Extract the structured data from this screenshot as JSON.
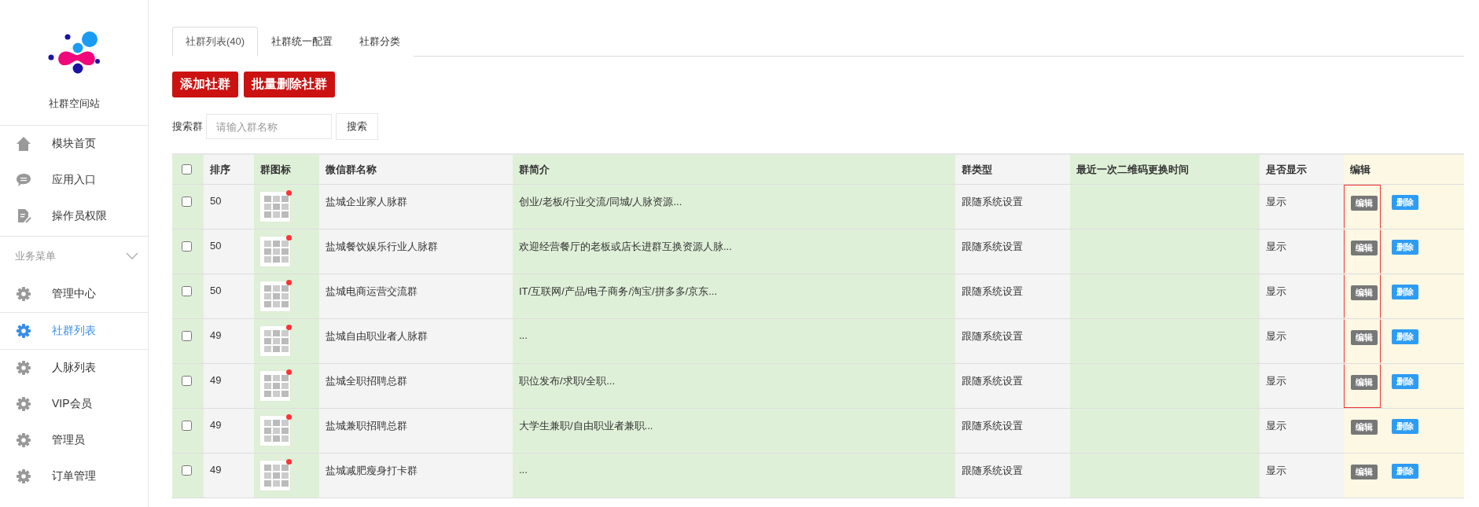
{
  "sidebar": {
    "site_title": "社群空间站",
    "top_items": [
      {
        "label": "模块首页"
      },
      {
        "label": "应用入口"
      },
      {
        "label": "操作员权限"
      }
    ],
    "section": {
      "title": "业务菜单",
      "expanded": true
    },
    "items": [
      {
        "label": "管理中心",
        "selected": false
      },
      {
        "label": "社群列表",
        "selected": true
      },
      {
        "label": "人脉列表",
        "selected": false
      },
      {
        "label": "VIP会员",
        "selected": false
      },
      {
        "label": "管理员",
        "selected": false
      },
      {
        "label": "订单管理",
        "selected": false
      }
    ]
  },
  "tabs": [
    {
      "label": "社群列表(40)",
      "selected": true
    },
    {
      "label": "社群统一配置",
      "selected": false
    },
    {
      "label": "社群分类",
      "selected": false
    }
  ],
  "actions": [
    "添加社群",
    "批量删除社群"
  ],
  "search": {
    "label": "搜索群",
    "placeholder": "请输入群名称",
    "button": "搜索"
  },
  "table": {
    "all_checked": false,
    "columns": [
      "排序",
      "群图标",
      "微信群名称",
      "群简介",
      "群类型",
      "最近一次二维码更换时间",
      "是否显示",
      "编辑"
    ],
    "rows": [
      {
        "checked": false,
        "sort": "50",
        "name": "盐城企业家人脉群",
        "intro": "创业/老板/行业交流/同城/人脉资源...",
        "type": "跟随系统设置",
        "display": "显示",
        "edit": "编辑",
        "delete": "删除",
        "highlighted": true
      },
      {
        "checked": false,
        "sort": "50",
        "name": "盐城餐饮娱乐行业人脉群",
        "intro": "欢迎经营餐厅的老板或店长进群互换资源人脉...",
        "type": "跟随系统设置",
        "display": "显示",
        "edit": "编辑",
        "delete": "删除",
        "highlighted": true
      },
      {
        "checked": false,
        "sort": "50",
        "name": "盐城电商运营交流群",
        "intro": "IT/互联网/产品/电子商务/淘宝/拼多多/京东...",
        "type": "跟随系统设置",
        "display": "显示",
        "edit": "编辑",
        "delete": "删除",
        "highlighted": true
      },
      {
        "checked": false,
        "sort": "49",
        "name": "盐城自由职业者人脉群",
        "intro": "...",
        "type": "跟随系统设置",
        "display": "显示",
        "edit": "编辑",
        "delete": "删除",
        "highlighted": true
      },
      {
        "checked": false,
        "sort": "49",
        "name": "盐城全职招聘总群",
        "intro": "职位发布/求职/全职...",
        "type": "跟随系统设置",
        "display": "显示",
        "edit": "编辑",
        "delete": "删除",
        "highlighted": true
      },
      {
        "checked": false,
        "sort": "49",
        "name": "盐城兼职招聘总群",
        "intro": "大学生兼职/自由职业者兼职...",
        "type": "跟随系统设置",
        "display": "显示",
        "edit": "编辑",
        "delete": "删除",
        "highlighted": false
      },
      {
        "checked": false,
        "sort": "49",
        "name": "盐城减肥瘦身打卡群",
        "intro": "...",
        "type": "跟随系统设置",
        "display": "显示",
        "edit": "编辑",
        "delete": "删除",
        "highlighted": false
      }
    ]
  }
}
